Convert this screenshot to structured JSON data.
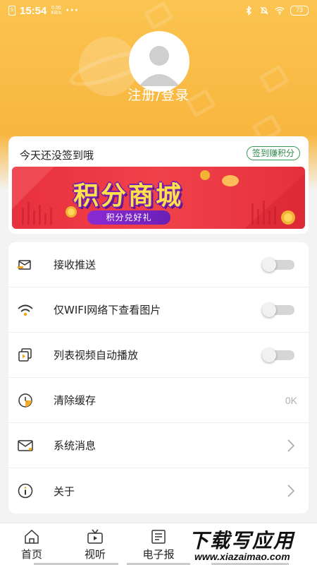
{
  "status_bar": {
    "time": "15:54",
    "speed_value": "0.00",
    "speed_unit": "KB/s",
    "more": "···",
    "battery": "73"
  },
  "profile": {
    "login_label": "注册/登录"
  },
  "signin": {
    "prompt": "今天还没签到哦",
    "earn_points_label": "签到赚积分",
    "banner_title": "积分商城",
    "banner_subtitle": "积分兑好礼"
  },
  "settings": {
    "items": [
      {
        "label": "接收推送",
        "icon": "message-icon",
        "control": "toggle",
        "on": false
      },
      {
        "label": "仅WIFI网络下查看图片",
        "icon": "wifi-icon",
        "control": "toggle",
        "on": false
      },
      {
        "label": "列表视频自动播放",
        "icon": "video-play-icon",
        "control": "toggle",
        "on": false
      },
      {
        "label": "清除缓存",
        "icon": "clock-icon",
        "control": "value",
        "value": "0K"
      },
      {
        "label": "系统消息",
        "icon": "mail-icon",
        "control": "chevron"
      },
      {
        "label": "关于",
        "icon": "info-icon",
        "control": "chevron"
      }
    ]
  },
  "tabbar": {
    "tabs": [
      {
        "label": "首页",
        "icon": "home-icon"
      },
      {
        "label": "视听",
        "icon": "tv-icon"
      },
      {
        "label": "电子报",
        "icon": "newspaper-icon"
      }
    ]
  },
  "watermark": {
    "main": "下载写应用",
    "sub": "www.xiazaimao.com"
  },
  "colors": {
    "header": "#fbc450",
    "accent_green": "#2f8a4e",
    "banner_red": "#e8303e",
    "banner_gold": "#ffe14a"
  }
}
